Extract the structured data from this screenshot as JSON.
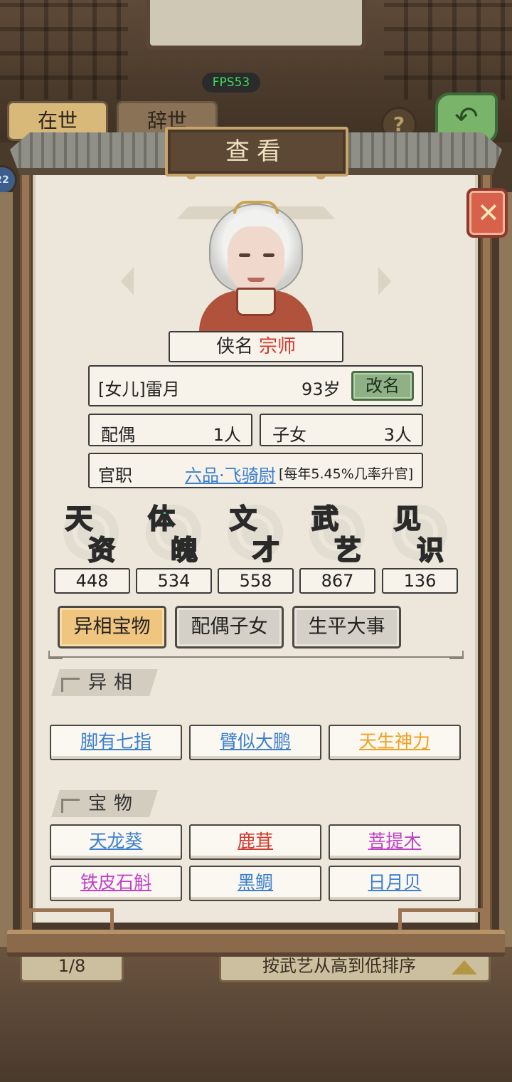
{
  "status": {
    "fps": "FPS53"
  },
  "background": {
    "tabs": [
      "在世",
      "辞世"
    ],
    "help_label": "?",
    "side_badge": "22",
    "pager": "1/8",
    "sort_label": "按武艺从高到低排序"
  },
  "dialog": {
    "title": "查看",
    "close_icon": "close-x-icon"
  },
  "character": {
    "hero_name_label": "侠名",
    "hero_title": "宗师",
    "name": "[女儿]雷月",
    "age": "93岁",
    "rename_label": "改名",
    "spouse_label": "配偶",
    "spouse_count": "1人",
    "children_label": "子女",
    "children_count": "3人",
    "office_label": "官职",
    "office_rank": "六品·飞骑尉",
    "office_rate": "[每年5.45%几率升官]"
  },
  "attributes": [
    {
      "c1": "天",
      "c2": "资",
      "value": "448",
      "color": "#3a7fe0"
    },
    {
      "c1": "体",
      "c2": "魄",
      "value": "534",
      "color": "#3cc07a"
    },
    {
      "c1": "文",
      "c2": "才",
      "value": "558",
      "color": "#a85fe0"
    },
    {
      "c1": "武",
      "c2": "艺",
      "value": "867",
      "color": "#e0b050"
    },
    {
      "c1": "见",
      "c2": "识",
      "value": "136",
      "color": "#e06a5a"
    }
  ],
  "tabs": [
    "异相宝物",
    "配偶子女",
    "生平大事"
  ],
  "active_tab": 0,
  "sections": {
    "traits_title": "异相",
    "traits": [
      {
        "label": "脚有七指",
        "color": "#3b7fd0"
      },
      {
        "label": "臂似大鹏",
        "color": "#3b7fd0"
      },
      {
        "label": "天生神力",
        "color": "#f0a020"
      }
    ],
    "treasures_title": "宝物",
    "treasures": [
      {
        "label": "天龙葵",
        "color": "#3b7fd0"
      },
      {
        "label": "鹿茸",
        "color": "#d03a30"
      },
      {
        "label": "菩提木",
        "color": "#c040c8"
      },
      {
        "label": "铁皮石斛",
        "color": "#c040c8"
      },
      {
        "label": "黑鲷",
        "color": "#3b7fd0"
      },
      {
        "label": "日月贝",
        "color": "#3b7fd0"
      }
    ]
  }
}
